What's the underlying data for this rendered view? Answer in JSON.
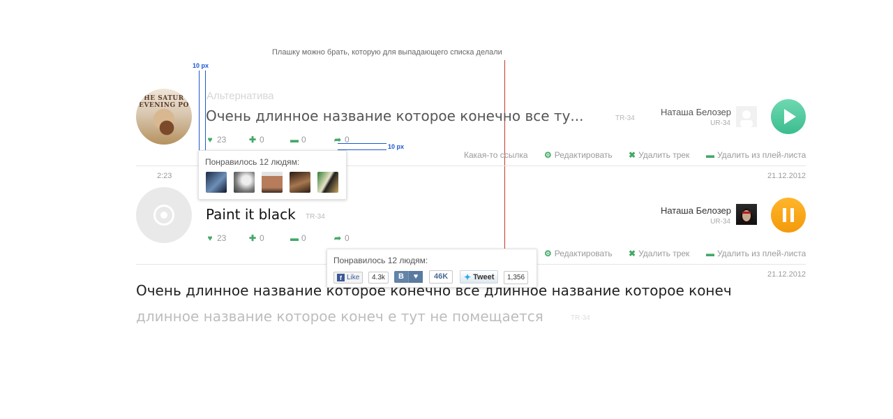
{
  "annotations": {
    "note": "Плашку можно брать, которую для выпадающего списка делали",
    "spacing_top": "10 px",
    "spacing_right": "10 px"
  },
  "track1": {
    "cover_text": "HE SATUR EVENING PO",
    "genre": "Альтернатива",
    "title": "Очень длинное название которое конечно все ту...",
    "code": "TR-34",
    "stats": {
      "likes": "23",
      "adds": "0",
      "comments": "0",
      "shares": "0"
    },
    "user_name": "Наташа Белозер",
    "user_code": "UR-34",
    "actions": [
      "Какая-то ссылка",
      "Редактировать",
      "Удалить трек",
      "Удалить из плей-листа"
    ],
    "duration": "2:23",
    "date": "21.12.2012"
  },
  "likes_popup": {
    "label": "Понравилось 12 людям:",
    "avatars": [
      "avatar-1",
      "avatar-2",
      "avatar-3",
      "avatar-4",
      "avatar-5"
    ]
  },
  "track2": {
    "title": "Paint it black",
    "code": "TR-34",
    "stats": {
      "likes": "23",
      "adds": "0",
      "comments": "0",
      "shares": "0"
    },
    "user_name": "Наташа Белозер",
    "user_code": "UR-34",
    "actions": [
      "Редактировать",
      "Удалить трек",
      "Удалить из плей-листа"
    ],
    "date": "21.12.2012"
  },
  "share_popup": {
    "label": "Понравилось 12 людям:",
    "fb_label": "Like",
    "fb_count": "4.3k",
    "vk_label": "В",
    "vk_count": "46K",
    "tw_label": "Tweet",
    "tw_count": "1,356"
  },
  "track3": {
    "title_line1": "Очень длинное название которое конечно все длинное название которое конеч",
    "title_line2": "длинное название которое конеч е тут не помещается",
    "code": "TR-34"
  },
  "colors": {
    "accent_green": "#43a867",
    "play_green": "#3bbd8f",
    "play_orange": "#f39a0b",
    "red_line": "#c0392b",
    "blue_guide": "#1a57d1"
  }
}
